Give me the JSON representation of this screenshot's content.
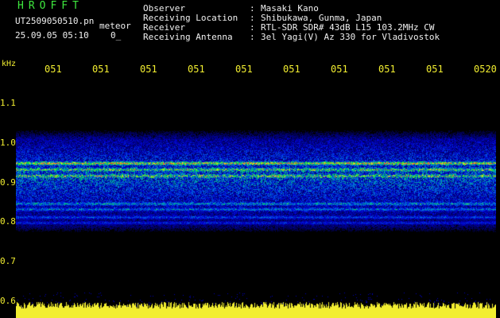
{
  "header": {
    "logo": "HROFFT",
    "filename": "UT2509050510.pn",
    "filename_suffix": "meteor",
    "datetime": "25.09.05 05:10",
    "datetime_extra": "0_"
  },
  "metadata": [
    {
      "label": "Observer",
      "value": "Masaki Kano"
    },
    {
      "label": "Receiving Location",
      "value": "Shibukawa, Gunma, Japan"
    },
    {
      "label": "Receiver",
      "value": "RTL-SDR SDR# 43dB L15 103.2MHz CW"
    },
    {
      "label": "Receiving Antenna",
      "value": "3el Yagi(V) Az 330 for Vladivostok"
    }
  ],
  "y_axis": {
    "unit": "kHz",
    "ticks": [
      "1.1",
      "1.0",
      "0.9",
      "0.8",
      "0.7",
      "0.6"
    ],
    "values": [
      1.1,
      1.0,
      0.9,
      0.8,
      0.7,
      0.6
    ]
  },
  "x_axis": {
    "ticks": [
      "051",
      "051",
      "051",
      "051",
      "051",
      "051",
      "051",
      "051",
      "051",
      "0520"
    ]
  },
  "colors": {
    "label_text": "#f0f0f0",
    "logo_green": "#3ee83e",
    "axis_yellow": "#f2ee30",
    "background": "#000000"
  }
}
